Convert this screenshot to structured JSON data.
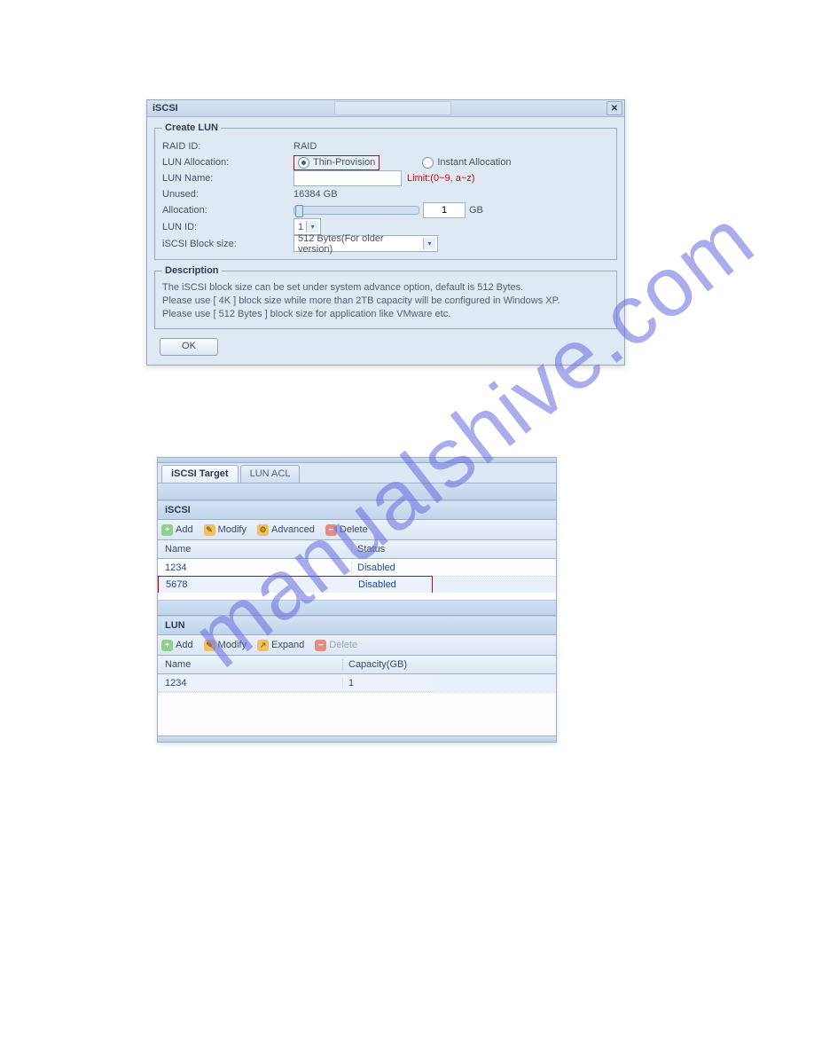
{
  "watermark": "manualshive.com",
  "dialog": {
    "title": "iSCSI",
    "fieldset_legend": "Create LUN",
    "labels": {
      "raid_id": "RAID ID:",
      "lun_alloc": "LUN Allocation:",
      "lun_name": "LUN Name:",
      "unused": "Unused:",
      "allocation": "Allocation:",
      "lun_id": "LUN ID:",
      "block_size": "iSCSI Block size:"
    },
    "values": {
      "raid_id": "RAID",
      "thin_provision": "Thin-Provision",
      "instant_allocation": "Instant Allocation",
      "lun_name_value": "",
      "limit_text": "Limit:(0~9, a~z)",
      "unused": "16384 GB",
      "alloc_value": "1",
      "alloc_unit": "GB",
      "lun_id_value": "1",
      "block_size_value": "512 Bytes(For older version)"
    },
    "description": {
      "legend": "Description",
      "line1": "The iSCSI block size can be set under system advance option, default is 512 Bytes.",
      "line2": "Please use [ 4K ] block size while more than 2TB capacity will be configured in Windows XP.",
      "line3": "Please use [ 512 Bytes ] block size for application like VMware etc."
    },
    "ok_label": "OK"
  },
  "panel": {
    "tabs": {
      "target": "iSCSI Target",
      "lun_acl": "LUN ACL"
    },
    "iscsi": {
      "header": "iSCSI",
      "toolbar": {
        "add": "Add",
        "modify": "Modify",
        "advanced": "Advanced",
        "delete": "Delete"
      },
      "columns": {
        "name": "Name",
        "status": "Status"
      },
      "rows": [
        {
          "name": "1234",
          "status": "Disabled"
        },
        {
          "name": "5678",
          "status": "Disabled"
        }
      ]
    },
    "lun": {
      "header": "LUN",
      "toolbar": {
        "add": "Add",
        "modify": "Modify",
        "expand": "Expand",
        "delete": "Delete"
      },
      "columns": {
        "name": "Name",
        "capacity": "Capacity(GB)"
      },
      "rows": [
        {
          "name": "1234",
          "capacity": "1"
        }
      ]
    }
  }
}
